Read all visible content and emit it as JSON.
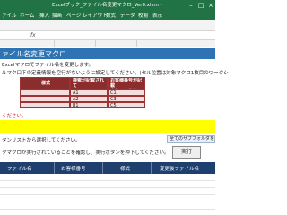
{
  "window": {
    "title": "Excelブック_ファイル名変更マクロ_Ver0.xlsm - ",
    "colors": {
      "excel_green": "#217346",
      "title_blue": "#2e74b5",
      "table_header": "#8b2d2d",
      "table_fill": "#f5dddd",
      "highlight_yellow": "#ffff00",
      "bottom_header": "#1f3f6e",
      "note_red": "#d11b1b"
    }
  },
  "ribbon": {
    "tabs": [
      "ァイル",
      "ホーム",
      "挿入",
      "描画",
      "ページ レイアウト",
      "数式",
      "データ",
      "校閲",
      "表示"
    ]
  },
  "sheet": {
    "title": "ァイル名変更マクロ",
    "lines": [
      "Excelマクロでファイル名を変更します。",
      "ルマク口下の定義情報を空行がないように設定してください。(セル位置は対象マクロ1枚目のワークシ"
    ],
    "table": {
      "headers": [
        "様式",
        "検索が記載されて\nいるセル",
        "お客様番号が記載\nされているセル"
      ],
      "rows": [
        [
          "",
          "A1",
          "C1"
        ],
        [
          "",
          "A2",
          "C3"
        ],
        [
          "",
          "B1",
          "C5"
        ]
      ]
    },
    "note": "ください。",
    "yellow_band": "",
    "instruction": "タンリストから選択してください。",
    "dropdown_value": "全てのサブフォルダを含む",
    "run_instruction": "クマクロが実行されていることを確認し、実行ボタンを押下してください。",
    "run_button": "実行",
    "bottom_table_headers": [
      "ファイル名",
      "お客様番号",
      "様式",
      "変更後ファイル名"
    ]
  }
}
